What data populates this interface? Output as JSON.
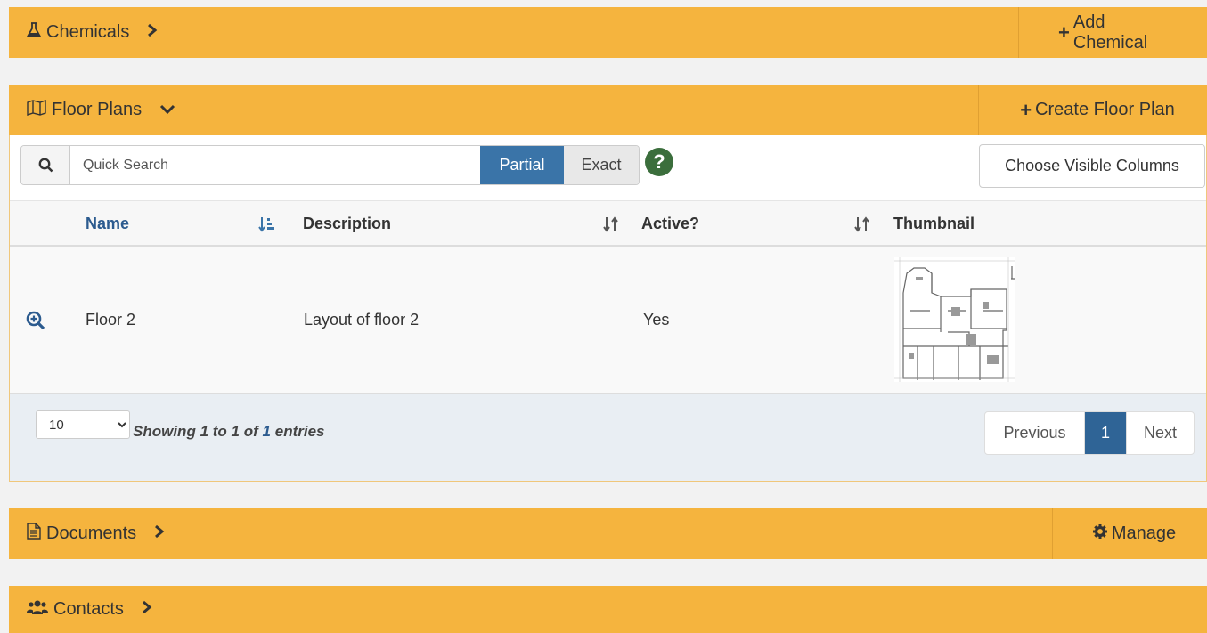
{
  "colors": {
    "panel_bar": "#f5b43e",
    "primary": "#3a74a8",
    "link": "#2c5b8f",
    "help": "#3b6e3c"
  },
  "chemicals": {
    "title": "Chemicals",
    "icon": "flask-icon",
    "action_label": "Add Chemical"
  },
  "floor_plans": {
    "title": "Floor Plans",
    "icon": "map-icon",
    "action_label": "Create Floor Plan",
    "search": {
      "placeholder": "Quick Search",
      "value": "",
      "partial_label": "Partial",
      "exact_label": "Exact"
    },
    "choose_columns_label": "Choose Visible Columns",
    "columns": [
      "Name",
      "Description",
      "Active?",
      "Thumbnail"
    ],
    "rows": [
      {
        "name": "Floor 2",
        "description": "Layout of floor 2",
        "active": "Yes"
      }
    ],
    "page_size": "10",
    "info": {
      "prefix": "Showing",
      "from": "1",
      "to_word": "to",
      "to": "1",
      "of_word": "of",
      "total": "1",
      "suffix": "entries"
    },
    "pager": {
      "previous": "Previous",
      "current": "1",
      "next": "Next"
    }
  },
  "documents": {
    "title": "Documents",
    "icon": "file-text-icon",
    "action_label": "Manage"
  },
  "contacts": {
    "title": "Contacts",
    "icon": "users-icon"
  }
}
